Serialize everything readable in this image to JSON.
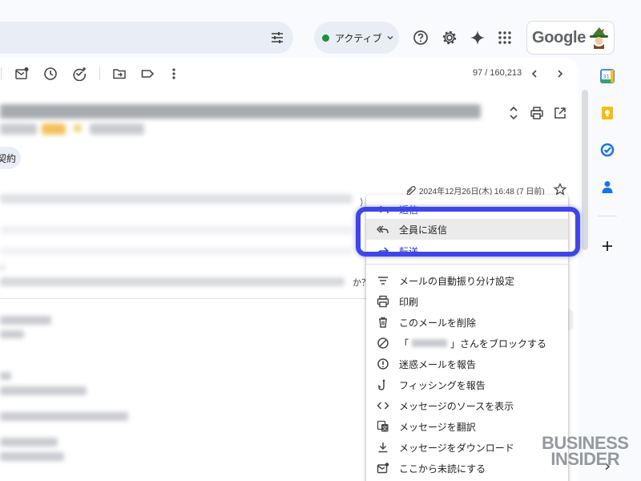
{
  "topbar": {
    "status_label": "アクティブ",
    "google_logo": "Google"
  },
  "toolbar": {
    "pager": "97 / 160,213"
  },
  "label_chip": "契約",
  "email": {
    "date": "2024年12月26日(木) 16:48 (7 日前)",
    "fragment_yo": "）よ",
    "fragment_ka": "か？"
  },
  "menu": {
    "items": [
      {
        "label": "返信",
        "icon": "reply-icon"
      },
      {
        "label": "全員に返信",
        "icon": "reply-all-icon"
      },
      {
        "label": "転送",
        "icon": "forward-icon"
      },
      {
        "label": "メールの自動振り分け設定",
        "icon": "filter-icon"
      },
      {
        "label": "印刷",
        "icon": "print-icon"
      },
      {
        "label": "このメールを削除",
        "icon": "trash-icon"
      },
      {
        "label_prefix": "「",
        "label_suffix": "」さんをブロックする",
        "icon": "block-icon"
      },
      {
        "label": "迷惑メールを報告",
        "icon": "spam-icon"
      },
      {
        "label": "フィッシングを報告",
        "icon": "phishing-icon"
      },
      {
        "label": "メッセージのソースを表示",
        "icon": "code-icon"
      },
      {
        "label": "メッセージを翻訳",
        "icon": "translate-icon"
      },
      {
        "label": "メッセージをダウンロード",
        "icon": "download-icon"
      },
      {
        "label": "ここから未読にする",
        "icon": "mark-unread-icon"
      }
    ]
  },
  "watermark": {
    "line1": "BUSINESS",
    "line2": "INSIDER"
  },
  "colors": {
    "highlight": "#3f46e8",
    "active_dot": "#1e8e3e",
    "menu_blue_text": "#2d38c8"
  }
}
